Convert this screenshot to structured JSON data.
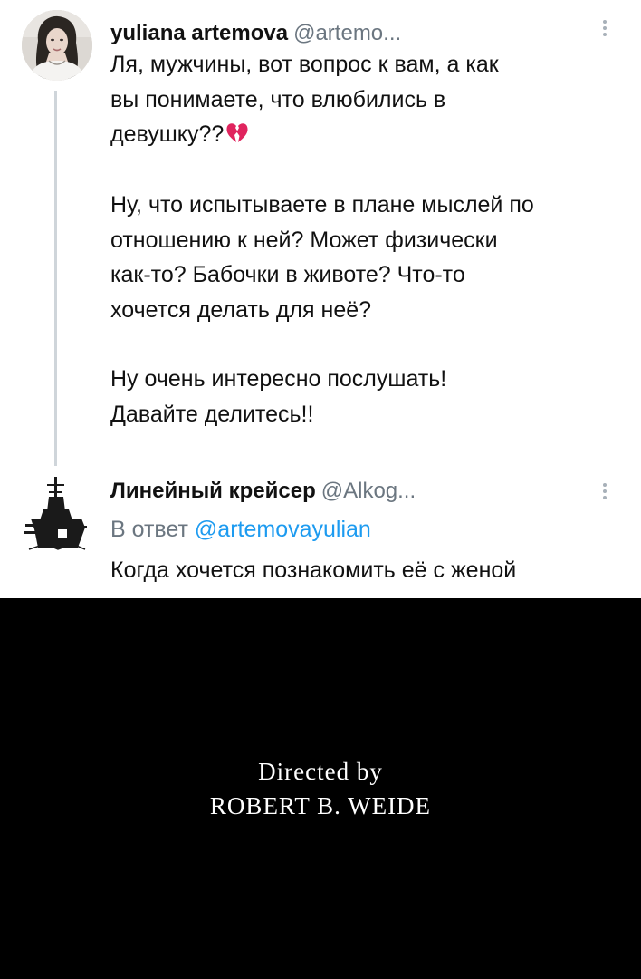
{
  "tweet_main": {
    "display_name": "yuliana artemova",
    "handle": "@artemo...",
    "avatar_icon": "user-photo-icon",
    "more_icon": "more-options-vertical-icon",
    "paragraph1_lines": [
      "Ля, мужчины, вот вопрос к вам, а как",
      "вы понимаете, что влюбились в",
      "девушку??"
    ],
    "emoji": "broken-heart-icon",
    "paragraph2_lines": [
      "Ну, что испытываете в плане мыслей по",
      "отношению к ней? Может физически",
      "как-то? Бабочки в животе? Что-то",
      "хочется делать для неё?"
    ],
    "paragraph3_lines": [
      "Ну очень интересно послушать!",
      "Давайте делитесь!!"
    ]
  },
  "tweet_reply": {
    "display_name": "Линейный крейсер",
    "handle": "@Alkog...",
    "avatar_icon": "battleship-icon",
    "more_icon": "more-options-vertical-icon",
    "reply_prefix": "В ответ",
    "reply_to_handle": "@artemovayulian",
    "text": "Когда хочется познакомить её с женой"
  },
  "credits": {
    "line1": "Directed by",
    "line2": "ROBERT B. WEIDE"
  },
  "colors": {
    "link": "#1d9bf0",
    "secondary_text": "#6b7680",
    "thread_line": "#cfd5da",
    "heart": "#e0245e",
    "credits_bg": "#000000"
  }
}
